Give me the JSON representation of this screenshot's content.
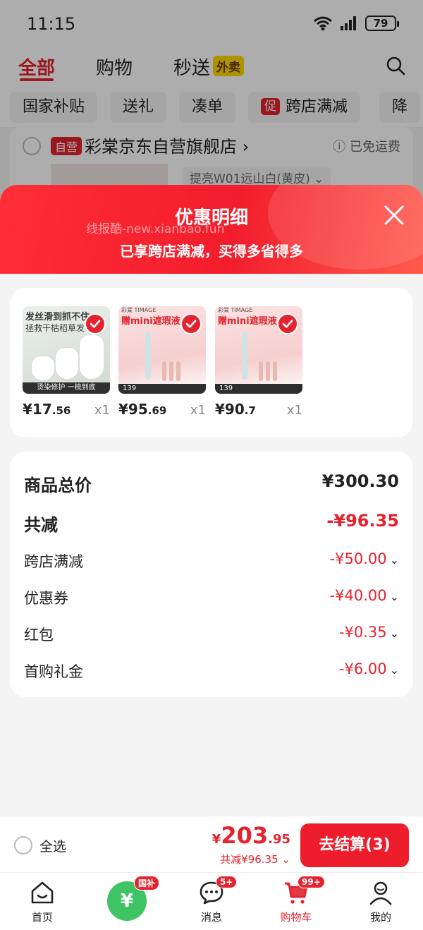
{
  "status": {
    "time": "11:15",
    "battery": "79"
  },
  "header": {
    "tabs": [
      {
        "label": "全部"
      },
      {
        "label": "购物"
      },
      {
        "label": "秒送"
      }
    ],
    "waimai_badge": "外卖"
  },
  "filters": [
    {
      "label": "国家补贴"
    },
    {
      "label": "送礼"
    },
    {
      "label": "凑单"
    },
    {
      "label": "跨店满减",
      "tag": "促"
    },
    {
      "label": "降"
    }
  ],
  "store": {
    "badge": "自营",
    "name": "彩棠京东自营旗舰店",
    "shipping": "已免运费",
    "variant": "提亮W01远山白(黄皮)"
  },
  "sheet": {
    "title": "优惠明细",
    "subtitle": "已享跨店满减，买得多省得多",
    "watermark": "线报酷-new.xianbao.fun"
  },
  "products": [
    {
      "price_int": "¥17",
      "price_dec": ".56",
      "qty": "x1",
      "img_text1": "发丝滑到抓不住",
      "img_text2": "拯救干枯稻草发",
      "img_strip": "烫染修护 一梳到底"
    },
    {
      "price_int": "¥95",
      "price_dec": ".69",
      "qty": "x1",
      "img_brand": "彩棠 TIMAGE",
      "img_title": "赠mini遮瑕液",
      "img_price": "139"
    },
    {
      "price_int": "¥90",
      "price_dec": ".7",
      "qty": "x1",
      "img_brand": "彩棠 TIMAGE",
      "img_title": "赠mini遮瑕液",
      "img_price": "139"
    }
  ],
  "details": {
    "total_label": "商品总价",
    "total_value": "¥300.30",
    "discount_label": "共减",
    "discount_value": "-¥96.35",
    "items": [
      {
        "label": "跨店满减",
        "value": "-¥50.00"
      },
      {
        "label": "优惠券",
        "value": "-¥40.00"
      },
      {
        "label": "红包",
        "value": "-¥0.35"
      },
      {
        "label": "首购礼金",
        "value": "-¥6.00"
      }
    ]
  },
  "checkout": {
    "select_all": "全选",
    "price_yen": "¥",
    "price_int": "203",
    "price_dec": ".95",
    "discount_text": "共减¥96.35",
    "button": "去结算(3)"
  },
  "nav": [
    {
      "label": "首页",
      "icon": "home-icon"
    },
    {
      "label": "",
      "icon": "national-subsidy-icon",
      "badge": "国补",
      "glyph": "¥"
    },
    {
      "label": "消息",
      "icon": "message-icon",
      "badge": "5+"
    },
    {
      "label": "购物车",
      "icon": "cart-icon",
      "badge": "99+",
      "active": true
    },
    {
      "label": "我的",
      "icon": "profile-icon"
    }
  ],
  "colors": {
    "accent": "#e4232e",
    "checkout_button": "#ee1d2b",
    "subsidy_green": "#3ec464"
  }
}
